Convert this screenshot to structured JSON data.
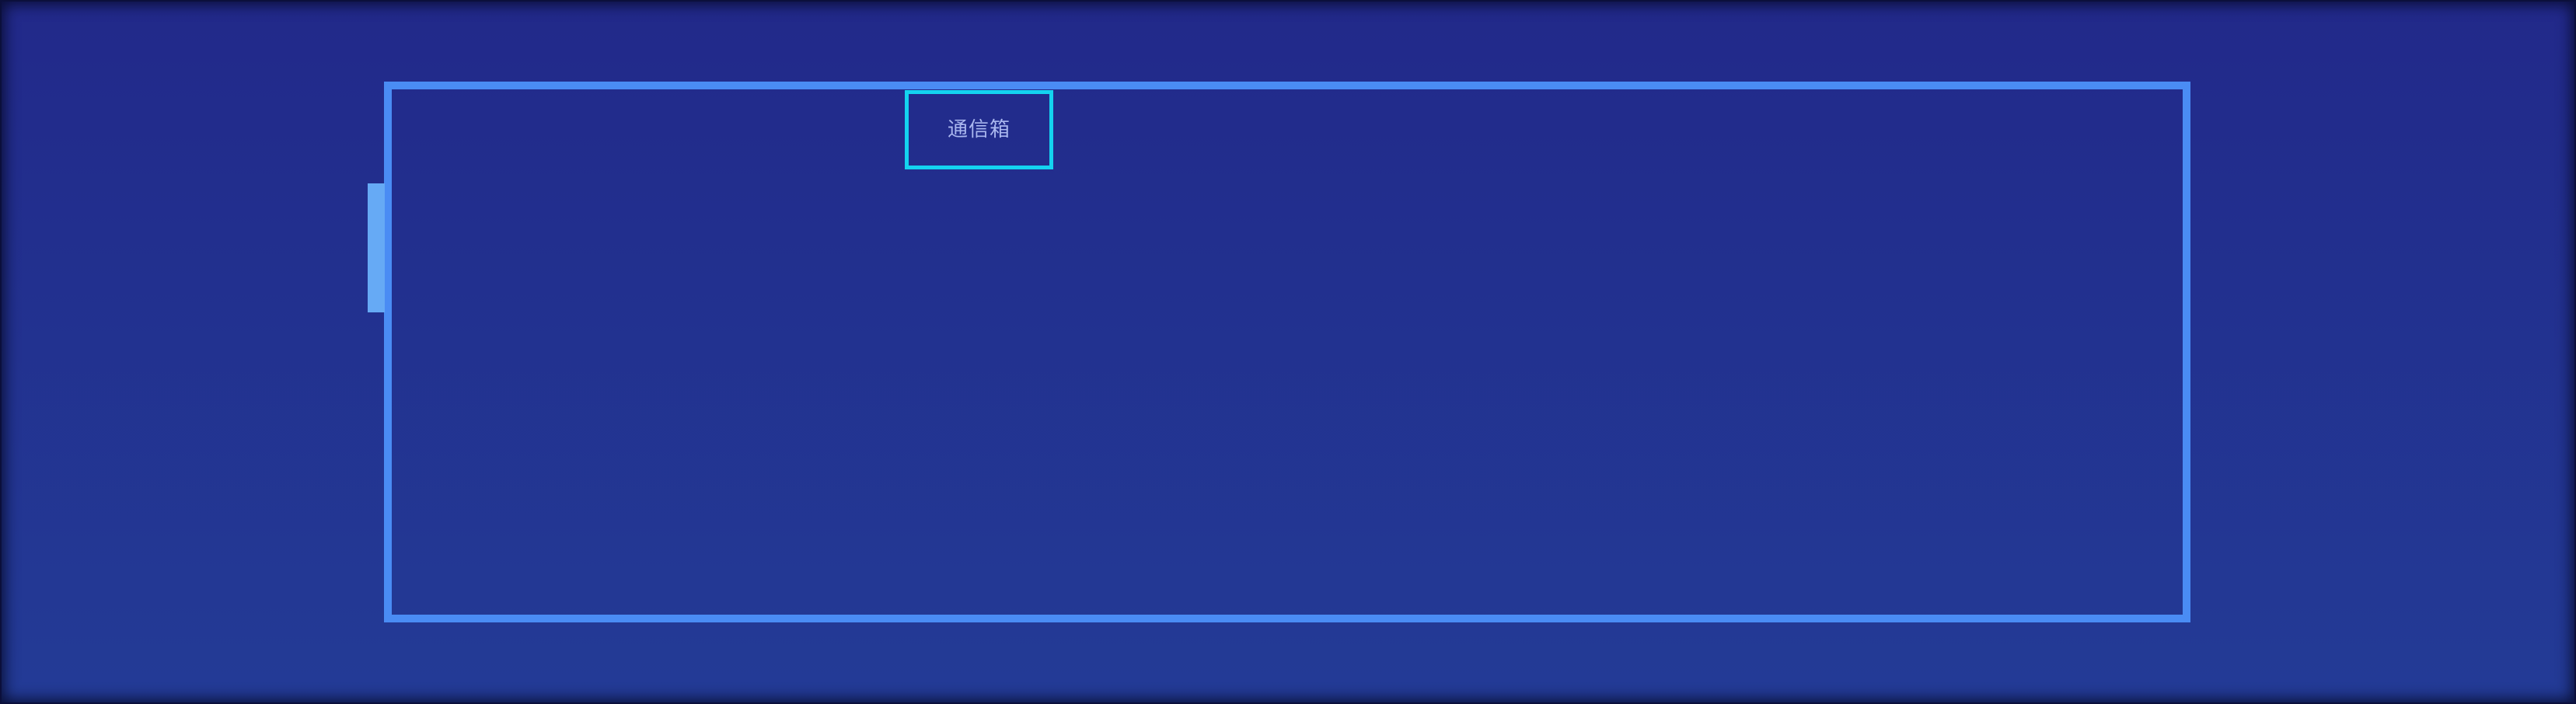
{
  "diagram": {
    "label": "通信箱"
  },
  "colors": {
    "background_top": "#22298a",
    "background_bottom": "#233b96",
    "frame": "#4a8cf4",
    "handle": "#66aaf5",
    "label_border": "#14d3f0",
    "label_text": "#aab7ef"
  }
}
